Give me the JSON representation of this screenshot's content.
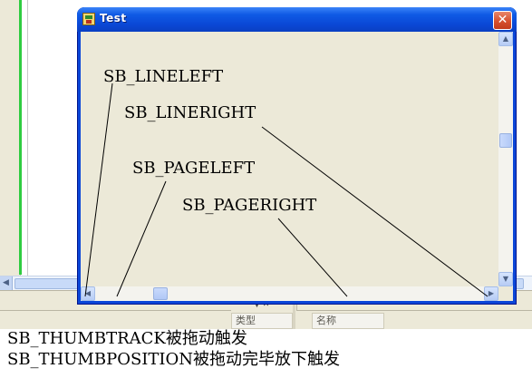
{
  "window": {
    "title": "Test",
    "close_glyph": "✕"
  },
  "client": {
    "labels": {
      "sb_lineleft": "SB_LINELEFT",
      "sb_lineright": "SB_LINERIGHT",
      "sb_pageleft": "SB_PAGELEFT",
      "sb_pageright": "SB_PAGERIGHT"
    }
  },
  "notes": {
    "line1": "SB_THUMBTRACK被拖动触发",
    "line2": "SB_THUMBPOSITION被拖动完毕放下触发"
  },
  "background_panel": {
    "type_column": "类型",
    "name_column": "名称"
  },
  "icons": {
    "app": "app-icon",
    "close": "close-icon",
    "scroll_up": "scroll-up-arrow-icon",
    "scroll_down": "scroll-down-arrow-icon",
    "scroll_left": "scroll-left-arrow-icon",
    "scroll_right": "scroll-right-arrow-icon"
  },
  "colors": {
    "titlebar": "#0a48d6",
    "close_button": "#d6502e",
    "client_background": "#ece9d8",
    "editor_margin": "#2ecc40"
  }
}
